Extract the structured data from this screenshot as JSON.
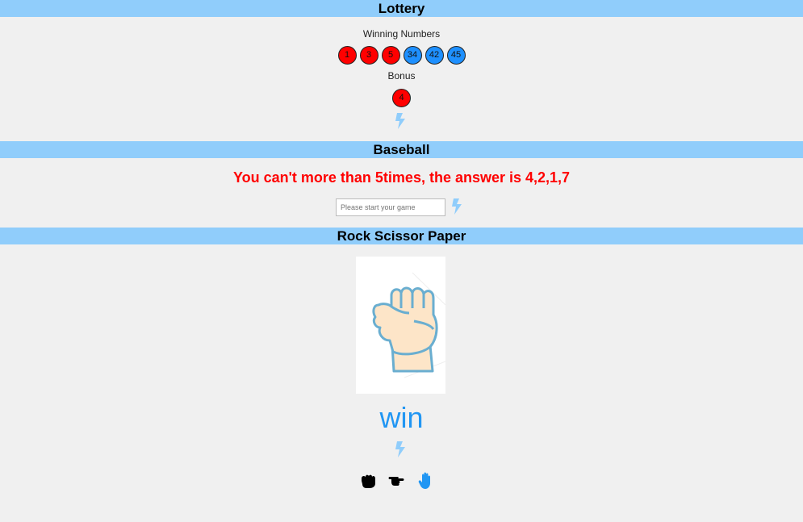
{
  "lottery": {
    "title": "Lottery",
    "winning_label": "Winning Numbers",
    "winning_numbers": [
      {
        "value": "1",
        "color": "#ff0000"
      },
      {
        "value": "3",
        "color": "#ff0000"
      },
      {
        "value": "5",
        "color": "#ff0000"
      },
      {
        "value": "34",
        "color": "#1e90ff"
      },
      {
        "value": "42",
        "color": "#1e90ff"
      },
      {
        "value": "45",
        "color": "#1e90ff"
      }
    ],
    "bonus_label": "Bonus",
    "bonus_number": "4",
    "action_icon": "lightning-bolt-icon"
  },
  "baseball": {
    "title": "Baseball",
    "message": "You can't more than 5times, the answer is 4,2,1,7",
    "input_placeholder": "Please start your game",
    "input_value": "",
    "action_icon": "lightning-bolt-icon"
  },
  "rsp": {
    "title": "Rock Scissor Paper",
    "image_icon": "fist-hand-icon",
    "result": "win",
    "action_icon": "lightning-bolt-icon",
    "choices": [
      {
        "name": "rock-icon",
        "color": "#000000"
      },
      {
        "name": "scissors-icon",
        "color": "#000000"
      },
      {
        "name": "paper-icon",
        "color": "#2196f3"
      }
    ]
  },
  "colors": {
    "header_bg": "#90cdfb",
    "accent": "#2196f3",
    "error": "#ff0000",
    "bolt": "#90cdfb"
  }
}
